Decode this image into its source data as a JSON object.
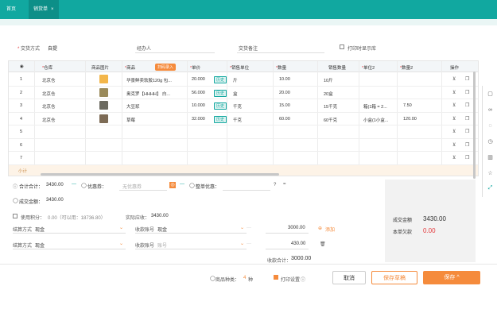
{
  "topbar": {
    "tabs": [
      {
        "label": "首页"
      },
      {
        "label": "销货单"
      }
    ],
    "close_glyph": "×"
  },
  "form": {
    "trade_label": "交货方式",
    "trade_value": "自提",
    "handler_label": "经办人",
    "remark_label": "交货备注",
    "check_label": "打印时显示库"
  },
  "table": {
    "headers": [
      "",
      "仓库",
      "商品图片",
      "商品",
      "单价",
      "销售单位",
      "数量",
      "销售数量",
      "单位2",
      "数量2",
      "操作"
    ],
    "scan_tag": "扫码录入",
    "rows": [
      {
        "no": "1",
        "warehouse": "北京仓",
        "product": "华景鲜卖软胶120g 包...",
        "price": "20.000",
        "hist": "历史",
        "unit": "斤",
        "qty": "10.00",
        "sale_qty": "10斤",
        "unit2": "",
        "qty2": "",
        "thumb": "#f3b64a"
      },
      {
        "no": "2",
        "warehouse": "北京仓",
        "product": "奥克罗【HHHH】 白...",
        "price": "56.000",
        "hist": "历史",
        "unit": "盒",
        "qty": "20.00",
        "sale_qty": "20盒",
        "unit2": "",
        "qty2": "",
        "thumb": "#9a8a5a"
      },
      {
        "no": "3",
        "warehouse": "北京仓",
        "product": "大豆浆",
        "price": "10.000",
        "hist": "历史",
        "unit": "千克",
        "qty": "15.00",
        "sale_qty": "15千克",
        "unit2": "箱(1箱 = 2...",
        "qty2": "7.50",
        "thumb": "#6c6a60"
      },
      {
        "no": "4",
        "warehouse": "北京仓",
        "product": "草莓",
        "price": "32.000",
        "hist": "历史",
        "unit": "千克",
        "qty": "60.00",
        "sale_qty": "60千克",
        "unit2": "小盒(1小盒...",
        "qty2": "120.00",
        "thumb": "#7d6b55"
      },
      {
        "no": "5",
        "warehouse": "",
        "product": "",
        "price": "",
        "hist": "",
        "unit": "",
        "qty": "",
        "sale_qty": "",
        "unit2": "",
        "qty2": "",
        "thumb": ""
      },
      {
        "no": "6",
        "warehouse": "",
        "product": "",
        "price": "",
        "hist": "",
        "unit": "",
        "qty": "",
        "sale_qty": "",
        "unit2": "",
        "qty2": "",
        "thumb": ""
      },
      {
        "no": "7",
        "warehouse": "",
        "product": "",
        "price": "",
        "hist": "",
        "unit": "",
        "qty": "",
        "sale_qty": "",
        "unit2": "",
        "qty2": "",
        "thumb": ""
      }
    ],
    "subtotal_label": "小计"
  },
  "totals": {
    "total_label": "合计合计：",
    "total_value": "3430.00",
    "discount_label": "优惠券：",
    "discount_placeholder": "无优惠券",
    "whole_discount": "整单优惠：",
    "deal_label": "成交金额：",
    "deal_value": "3430.00",
    "points_label": "使用积分：",
    "points_value": "0.00（可以用：18736.80）",
    "actual_label": "实际应收：",
    "actual_value": "3430.00",
    "settle_label": "结算方式",
    "settle_value": "现金",
    "settle2_label": "结算方式",
    "settle2_value": "现金",
    "acct_label": "收款账号",
    "acct_value": "现金",
    "acct2_label": "收款账号",
    "acct2_placeholder": "账号",
    "amt1": "3000.00",
    "amt2": "430.00",
    "add_label": "添加",
    "received_label": "收款合计：",
    "received_value": "3000.00"
  },
  "summary": {
    "deal_label": "成交金额",
    "deal_value": "3430.00",
    "owe_label": "本单欠款",
    "owe_value": "0.00"
  },
  "bottom": {
    "kinds_label": "商品种类：",
    "kinds_value": "4",
    "kinds_unit": "种",
    "print_label": "打印设置",
    "cancel_label": "取消",
    "save_draft_label": "保存草稿",
    "save_label": "保存 ^"
  },
  "colors": {
    "teal": "#11a8a0",
    "orange": "#f58b3c",
    "red": "#e4393c"
  }
}
